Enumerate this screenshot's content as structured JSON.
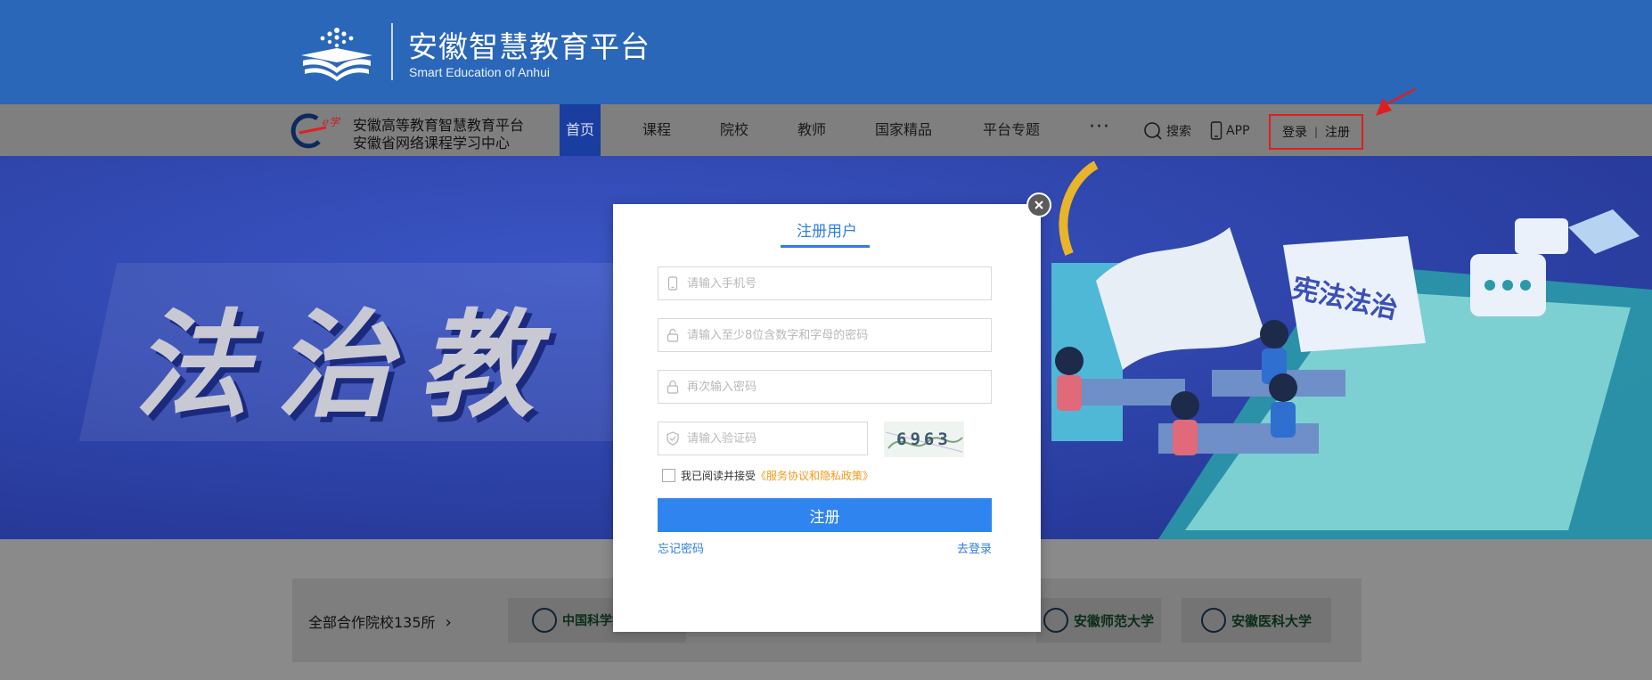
{
  "header": {
    "title": "安徽智慧教育平台",
    "subtitle": "Smart Education of Anhui"
  },
  "nav": {
    "brand_line1": "安徽高等教育智慧教育平台",
    "brand_line2": "安徽省网络课程学习中心",
    "items": [
      {
        "label": "首页",
        "active": true
      },
      {
        "label": "课程"
      },
      {
        "label": "院校"
      },
      {
        "label": "教师"
      },
      {
        "label": "国家精品"
      },
      {
        "label": "平台专题"
      }
    ],
    "more": "···",
    "search": "搜索",
    "app": "APP",
    "login": "登录",
    "separator": "|",
    "register": "注册"
  },
  "banner": {
    "title": "法治教",
    "sign_text": "宪法法治"
  },
  "partners": {
    "label": "全部合作院校135所",
    "arrow": "›",
    "logos": [
      "中国科学技术大学",
      "安徽师范大学",
      "安徽医科大学"
    ]
  },
  "modal": {
    "tab_title": "注册用户",
    "phone_placeholder": "请输入手机号",
    "password_placeholder": "请输入至少8位含数字和字母的密码",
    "confirm_placeholder": "再次输入密码",
    "code_placeholder": "请输入验证码",
    "captcha_text": "6963",
    "agree_text": "我已阅读并接受",
    "policy_link": "《服务协议和隐私政策》",
    "submit": "注册",
    "forgot": "忘记密码",
    "to_login": "去登录"
  },
  "colors": {
    "header_blue": "#2a67b8",
    "accent_blue": "#2f84f0",
    "policy_orange": "#f09a1a",
    "highlight_red": "#e01e1e"
  }
}
